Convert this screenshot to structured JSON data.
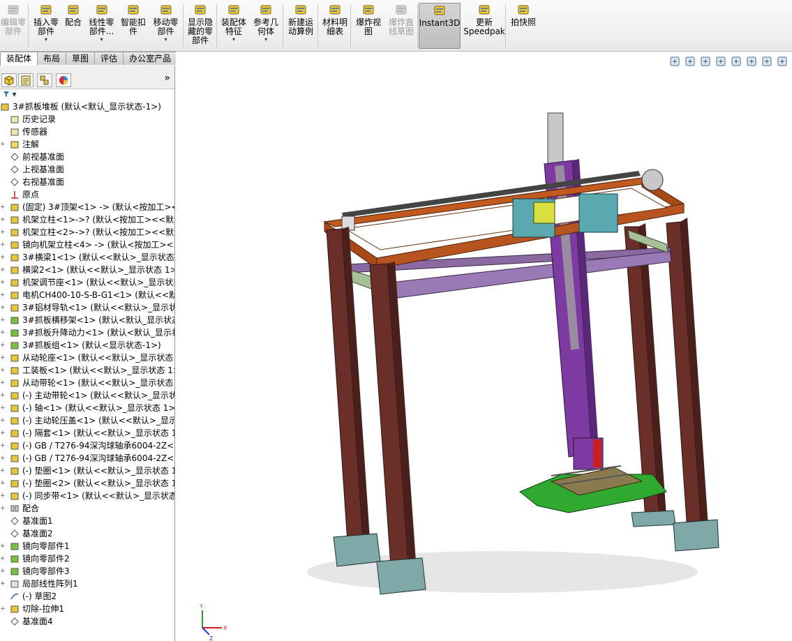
{
  "ribbon": {
    "tools": [
      {
        "name": "edit-component",
        "label": "编辑零\n部件",
        "disabled": true,
        "arrow": false
      },
      {
        "name": "insert-component",
        "label": "插入零\n部件",
        "disabled": false,
        "arrow": true
      },
      {
        "name": "mate",
        "label": "配合",
        "disabled": false,
        "arrow": false
      },
      {
        "name": "linear-pattern",
        "label": "线性零\n部件...",
        "disabled": false,
        "arrow": true
      },
      {
        "name": "smart-fasteners",
        "label": "智能扣\n件",
        "disabled": false,
        "arrow": false
      },
      {
        "name": "move-component",
        "label": "移动零\n部件",
        "disabled": false,
        "arrow": true
      },
      {
        "name": "show-hidden",
        "label": "显示隐\n藏的零\n部件",
        "disabled": false,
        "arrow": false
      },
      {
        "name": "assembly-features",
        "label": "装配体\n特征",
        "disabled": false,
        "arrow": true
      },
      {
        "name": "reference-geometry",
        "label": "参考几\n何体",
        "disabled": false,
        "arrow": true
      },
      {
        "name": "new-motion-study",
        "label": "新建运\n动算例",
        "disabled": false,
        "arrow": false
      },
      {
        "name": "bill-of-materials",
        "label": "材料明\n细表",
        "disabled": false,
        "arrow": false
      },
      {
        "name": "exploded-view",
        "label": "爆炸视\n图",
        "disabled": false,
        "arrow": false
      },
      {
        "name": "explode-line-sketch",
        "label": "爆炸直\n线草图",
        "disabled": true,
        "arrow": false
      },
      {
        "name": "instant3d",
        "label": "Instant3D",
        "disabled": false,
        "arrow": false
      },
      {
        "name": "update-speedpak",
        "label": "更新\nSpeedpak",
        "disabled": false,
        "arrow": false
      },
      {
        "name": "take-snapshot",
        "label": "拍快照",
        "disabled": false,
        "arrow": false
      }
    ]
  },
  "tabs": [
    "装配体",
    "布局",
    "草图",
    "评估",
    "办公室产品"
  ],
  "panel": {
    "expand_glyph": "»",
    "filter_glyph": "▼",
    "tree": [
      {
        "label": "3#抓板堆板  (默认<默认_显示状态-1>)",
        "indent": 0,
        "icon": "assembly",
        "pm": ""
      },
      {
        "label": "历史记录",
        "indent": 1,
        "icon": "history",
        "pm": ""
      },
      {
        "label": "传感器",
        "indent": 1,
        "icon": "sensor",
        "pm": ""
      },
      {
        "label": "注解",
        "indent": 1,
        "icon": "annotation",
        "pm": "+"
      },
      {
        "label": "前视基准面",
        "indent": 1,
        "icon": "plane",
        "pm": ""
      },
      {
        "label": "上视基准面",
        "indent": 1,
        "icon": "plane",
        "pm": ""
      },
      {
        "label": "右视基准面",
        "indent": 1,
        "icon": "plane",
        "pm": ""
      },
      {
        "label": "原点",
        "indent": 1,
        "icon": "origin",
        "pm": ""
      },
      {
        "label": "(固定) 3#顶架<1> -> (默认<按加工><",
        "indent": 1,
        "icon": "part",
        "pm": "+"
      },
      {
        "label": "机架立柱<1>->? (默认<按加工><<默认",
        "indent": 1,
        "icon": "part",
        "pm": "+"
      },
      {
        "label": "机架立柱<2>->? (默认<按加工><<默认",
        "indent": 1,
        "icon": "part",
        "pm": "+"
      },
      {
        "label": "镜向机架立柱<4> -> (默认<按加工><5",
        "indent": 1,
        "icon": "part",
        "pm": "+"
      },
      {
        "label": "3#横梁1<1> (默认<<默认>_显示状态 1",
        "indent": 1,
        "icon": "part",
        "pm": "+"
      },
      {
        "label": "横梁2<1> (默认<<默认>_显示状态 1>)",
        "indent": 1,
        "icon": "part",
        "pm": "+"
      },
      {
        "label": "机架调节座<1> (默认<<默认>_显示状态",
        "indent": 1,
        "icon": "part",
        "pm": "+"
      },
      {
        "label": "电机CH400-10-S-B-G1<1> (默认<<默认",
        "indent": 1,
        "icon": "part",
        "pm": "+"
      },
      {
        "label": "3#铝材导轨<1> (默认<<默认>_显示状",
        "indent": 1,
        "icon": "part",
        "pm": "+"
      },
      {
        "label": "3#抓板横移架<1> (默认<默认_显示状态",
        "indent": 1,
        "icon": "subasm",
        "pm": "+"
      },
      {
        "label": "3#抓板升降动力<1> (默认<默认_显示状",
        "indent": 1,
        "icon": "subasm",
        "pm": "+"
      },
      {
        "label": "3#抓板组<1> (默认<显示状态-1>)",
        "indent": 1,
        "icon": "subasm",
        "pm": "+"
      },
      {
        "label": "从动轮座<1> (默认<<默认>_显示状态",
        "indent": 1,
        "icon": "part",
        "pm": "+"
      },
      {
        "label": "工装板<1> (默认<<默认>_显示状态 1>",
        "indent": 1,
        "icon": "part",
        "pm": "+"
      },
      {
        "label": "从动带轮<1> (默认<<默认>_显示状态",
        "indent": 1,
        "icon": "part",
        "pm": "+"
      },
      {
        "label": "(-) 主动带轮<1> (默认<<默认>_显示状",
        "indent": 1,
        "icon": "part",
        "pm": "+"
      },
      {
        "label": "(-) 轴<1> (默认<<默认>_显示状态 1>)",
        "indent": 1,
        "icon": "part",
        "pm": "+"
      },
      {
        "label": "(-) 主动轮压盖<1> (默认<<默认>_显示",
        "indent": 1,
        "icon": "part",
        "pm": "+"
      },
      {
        "label": "(-) 隔套<1> (默认<<默认>_显示状态 1",
        "indent": 1,
        "icon": "part",
        "pm": "+"
      },
      {
        "label": "(-) GB / T276-94深沟球轴承6004-2Z<1",
        "indent": 1,
        "icon": "part",
        "pm": "+"
      },
      {
        "label": "(-) GB / T276-94深沟球轴承6004-2Z<2",
        "indent": 1,
        "icon": "part",
        "pm": "+"
      },
      {
        "label": "(-) 垫圈<1> (默认<<默认>_显示状态 1",
        "indent": 1,
        "icon": "part",
        "pm": "+"
      },
      {
        "label": "(-) 垫圈<2> (默认<<默认>_显示状态 1",
        "indent": 1,
        "icon": "part",
        "pm": "+"
      },
      {
        "label": "(-) 同步带<1> (默认<<默认>_显示状态",
        "indent": 1,
        "icon": "part",
        "pm": "+"
      },
      {
        "label": "配合",
        "indent": 1,
        "icon": "mates",
        "pm": "+"
      },
      {
        "label": "基准面1",
        "indent": 1,
        "icon": "plane",
        "pm": ""
      },
      {
        "label": "基准面2",
        "indent": 1,
        "icon": "plane",
        "pm": ""
      },
      {
        "label": "镜向零部件1",
        "indent": 1,
        "icon": "mirror",
        "pm": "+"
      },
      {
        "label": "镜向零部件2",
        "indent": 1,
        "icon": "mirror",
        "pm": "+"
      },
      {
        "label": "镜向零部件3",
        "indent": 1,
        "icon": "mirror",
        "pm": "+"
      },
      {
        "label": "局部线性阵列1",
        "indent": 1,
        "icon": "pattern",
        "pm": "+"
      },
      {
        "label": "(-) 草图2",
        "indent": 1,
        "icon": "sketch",
        "pm": ""
      },
      {
        "label": "切除-拉伸1",
        "indent": 1,
        "icon": "cut",
        "pm": "+"
      },
      {
        "label": "基准面4",
        "indent": 1,
        "icon": "plane",
        "pm": ""
      }
    ]
  },
  "viewport": {
    "triad": {
      "x": "X",
      "y": "Y",
      "z": "Z"
    },
    "hud_icons": [
      "zoom-to-fit-icon",
      "zoom-area-icon",
      "previous-view-icon",
      "section-view-icon",
      "view-orientation-icon",
      "display-style-icon",
      "hide-show-items-icon",
      "edit-appearance-icon"
    ]
  },
  "colors": {
    "column": "#6b2f2a",
    "top_frame": "#a84a17",
    "beam": "#8a6aa0",
    "crossbar": "#a8c09a",
    "foot": "#7fa8a8",
    "vertical": "#7d3aa0",
    "gripper": "#2faa2f"
  }
}
